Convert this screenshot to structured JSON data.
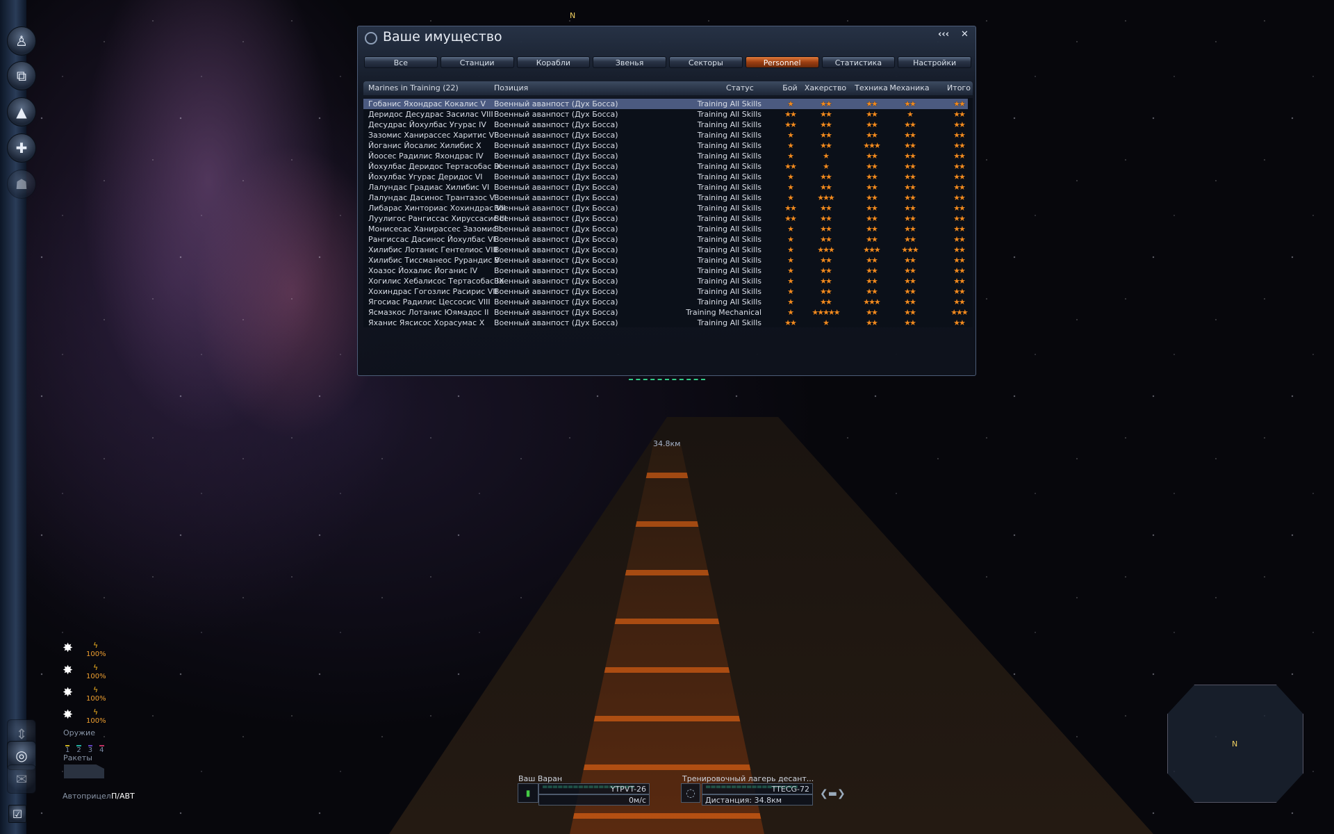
{
  "hud": {
    "compass_north": "N",
    "target_distance_label": "34.8км",
    "radar_north": "N"
  },
  "panel": {
    "title": "Ваше имущество",
    "collapse_label": "‹‹‹",
    "close_label": "✕",
    "tabs": [
      {
        "label": "Все"
      },
      {
        "label": "Станции"
      },
      {
        "label": "Корабли"
      },
      {
        "label": "Звенья"
      },
      {
        "label": "Секторы"
      },
      {
        "label": "Personnel",
        "active": true
      },
      {
        "label": "Статистика"
      },
      {
        "label": "Настройки"
      }
    ],
    "columns": {
      "name": "Marines in Training (22)",
      "position": "Позиция",
      "status": "Статус",
      "combat": "Бой",
      "hacking": "Хакерство",
      "engineering": "Техника",
      "mechanics": "Механика",
      "total": "Итого"
    },
    "star_color": "#f08a20",
    "selected_row": 0,
    "rows": [
      {
        "name": "Гобанис Яхондрас Кокалис V",
        "position": "Военный аванпост (Дух Босса)",
        "status": "Training All Skills",
        "stars": [
          1,
          2,
          2,
          2,
          2
        ]
      },
      {
        "name": "Деридос Десудрас Засилас VIII",
        "position": "Военный аванпост (Дух Босса)",
        "status": "Training All Skills",
        "stars": [
          2,
          2,
          2,
          1,
          2
        ]
      },
      {
        "name": "Десудрас Йохулбас Угурас IV",
        "position": "Военный аванпост (Дух Босса)",
        "status": "Training All Skills",
        "stars": [
          2,
          2,
          2,
          2,
          2
        ]
      },
      {
        "name": "Зазомис Ханирассес Харитис VI",
        "position": "Военный аванпост (Дух Босса)",
        "status": "Training All Skills",
        "stars": [
          1,
          2,
          2,
          2,
          2
        ]
      },
      {
        "name": "Йоганис Йосалис Хилибис X",
        "position": "Военный аванпост (Дух Босса)",
        "status": "Training All Skills",
        "stars": [
          1,
          2,
          3,
          2,
          2
        ]
      },
      {
        "name": "Йоосес Радилис Яхондрас IV",
        "position": "Военный аванпост (Дух Босса)",
        "status": "Training All Skills",
        "stars": [
          1,
          1,
          2,
          2,
          2
        ]
      },
      {
        "name": "Йохулбас Деридос Тертасобас IX",
        "position": "Военный аванпост (Дух Босса)",
        "status": "Training All Skills",
        "stars": [
          2,
          1,
          2,
          2,
          2
        ]
      },
      {
        "name": "Йохулбас Угурас Деридос VI",
        "position": "Военный аванпост (Дух Босса)",
        "status": "Training All Skills",
        "stars": [
          1,
          2,
          2,
          2,
          2
        ]
      },
      {
        "name": "Лалундас Градиас Хилибис VI",
        "position": "Военный аванпост (Дух Босса)",
        "status": "Training All Skills",
        "stars": [
          1,
          2,
          2,
          2,
          2
        ]
      },
      {
        "name": "Лалундас Дасинос Трантазос V",
        "position": "Военный аванпост (Дух Босса)",
        "status": "Training All Skills",
        "stars": [
          1,
          3,
          2,
          2,
          2
        ]
      },
      {
        "name": "Либарас Хинториас Хохиндрас VII",
        "position": "Военный аванпост (Дух Босса)",
        "status": "Training All Skills",
        "stars": [
          2,
          2,
          2,
          2,
          2
        ]
      },
      {
        "name": "Луулигос Рангиссас Хируссасис III",
        "position": "Военный аванпост (Дух Босса)",
        "status": "Training All Skills",
        "stars": [
          2,
          2,
          2,
          2,
          2
        ]
      },
      {
        "name": "Монисесас Ханирассес Зазомис I",
        "position": "Военный аванпост (Дух Босса)",
        "status": "Training All Skills",
        "stars": [
          1,
          2,
          2,
          2,
          2
        ]
      },
      {
        "name": "Рангиссас Дасинос Йохулбас VI",
        "position": "Военный аванпост (Дух Босса)",
        "status": "Training All Skills",
        "stars": [
          1,
          2,
          2,
          2,
          2
        ]
      },
      {
        "name": "Хилибис Лотанис Гентелиос VIII",
        "position": "Военный аванпост (Дух Босса)",
        "status": "Training All Skills",
        "stars": [
          1,
          3,
          3,
          3,
          2
        ]
      },
      {
        "name": "Хилибис Тиссманеос Рурандис V",
        "position": "Военный аванпост (Дух Босса)",
        "status": "Training All Skills",
        "stars": [
          1,
          2,
          2,
          2,
          2
        ]
      },
      {
        "name": "Хоазос Йохалис Йоганис IV",
        "position": "Военный аванпост (Дух Босса)",
        "status": "Training All Skills",
        "stars": [
          1,
          2,
          2,
          2,
          2
        ]
      },
      {
        "name": "Хогилис Хебалисос Тертасобас IX",
        "position": "Военный аванпост (Дух Босса)",
        "status": "Training All Skills",
        "stars": [
          1,
          2,
          2,
          2,
          2
        ]
      },
      {
        "name": "Хохиндрас Гогозлис Расирис VII",
        "position": "Военный аванпост (Дух Босса)",
        "status": "Training All Skills",
        "stars": [
          1,
          2,
          2,
          2,
          2
        ]
      },
      {
        "name": "Ягосиас Радилис Цессосис VIII",
        "position": "Военный аванпост (Дух Босса)",
        "status": "Training All Skills",
        "stars": [
          1,
          2,
          3,
          2,
          2
        ]
      },
      {
        "name": "Ясмазкос Лотанис Юямадос II",
        "position": "Военный аванпост (Дух Босса)",
        "status": "Training Mechanical",
        "stars": [
          1,
          5,
          2,
          2,
          3
        ]
      },
      {
        "name": "Яханис Яясисос Хорасумас X",
        "position": "Военный аванпост (Дух Босса)",
        "status": "Training All Skills",
        "stars": [
          2,
          1,
          2,
          2,
          2
        ]
      }
    ]
  },
  "weapons": {
    "slots": [
      {
        "charge": "100%"
      },
      {
        "charge": "100%"
      },
      {
        "charge": "100%"
      },
      {
        "charge": "100%"
      }
    ],
    "label": "Оружие",
    "groups": [
      "1",
      "2",
      "3",
      "4"
    ],
    "missiles_label": "Ракеты",
    "autoaim_label": "Автоприцел:",
    "autoaim_value": "П/АВТ"
  },
  "ship": {
    "name": "Ваш Варан",
    "id": "YTPVT-26",
    "speed": "0м/с"
  },
  "target": {
    "name": "Тренировочный лагерь десант...",
    "id": "TTECG-72",
    "distance": "Дистанция: 34.8км"
  }
}
